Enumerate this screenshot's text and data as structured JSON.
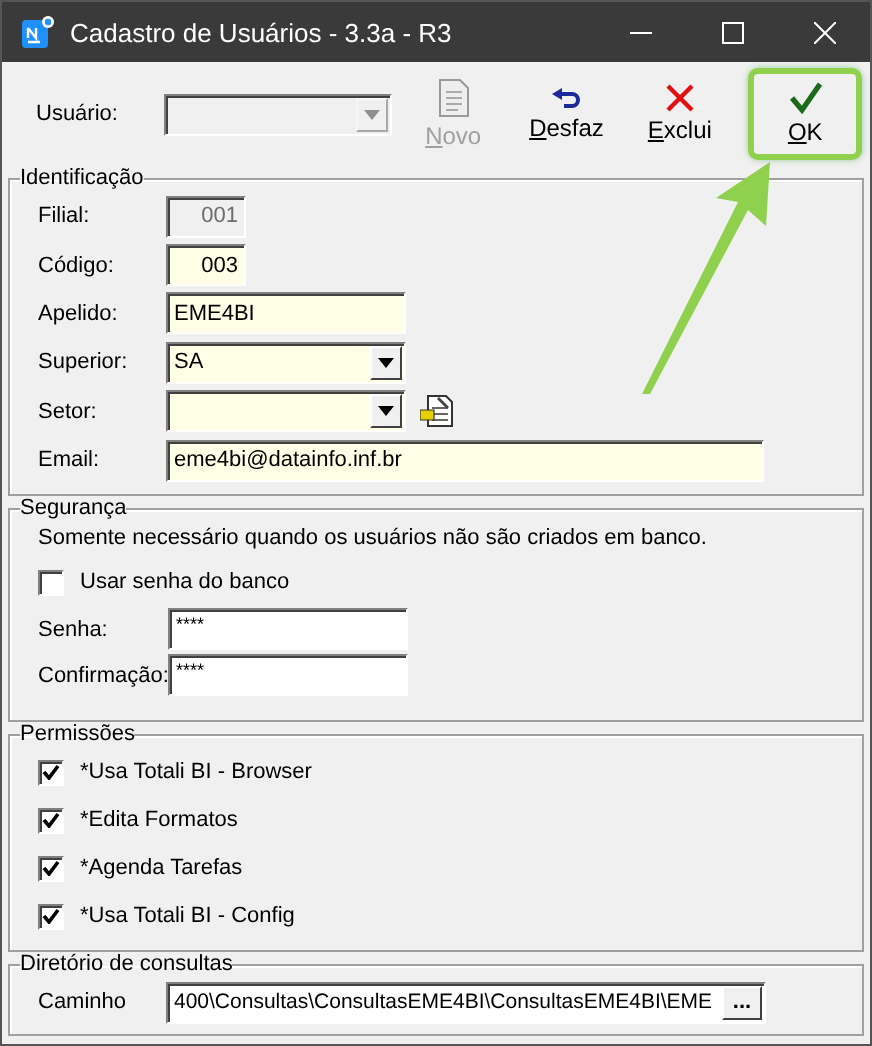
{
  "window": {
    "title": "Cadastro de Usuários - 3.3a - R3"
  },
  "toolbar": {
    "user_label": "Usuário:",
    "user_combo": {
      "disabled": true
    },
    "buttons": [
      {
        "label": "Novo",
        "kind": "new",
        "disabled": true,
        "highlighted": false
      },
      {
        "label": "Desfaz",
        "kind": "undo",
        "disabled": false,
        "highlighted": false
      },
      {
        "label": "Exclui",
        "kind": "delete",
        "disabled": false,
        "highlighted": false
      },
      {
        "label": "OK",
        "kind": "ok",
        "disabled": false,
        "highlighted": true
      }
    ]
  },
  "identificacao": {
    "title": "Identificação",
    "fields": [
      {
        "label": "Filial:",
        "kind": "code",
        "value": "001",
        "disabled": true
      },
      {
        "label": "Código:",
        "kind": "code",
        "value": "003",
        "disabled": false
      },
      {
        "label": "Apelido:",
        "kind": "text",
        "value": "EME4BI",
        "disabled": false
      },
      {
        "label": "Superior:",
        "kind": "combo",
        "value": "SA",
        "disabled": false
      },
      {
        "label": "Setor:",
        "kind": "combo",
        "disabled": false,
        "lookup": true
      },
      {
        "label": "Email:",
        "kind": "wide",
        "value": "eme4bi@datainfo.inf.br",
        "disabled": false
      }
    ]
  },
  "seguranca": {
    "title": "Segurança",
    "note": "Somente necessário quando os usuários não são criados em banco.",
    "checkbox": {
      "label": "Usar senha do banco",
      "checked": false
    },
    "fields": [
      {
        "label": "Senha:",
        "value": "****"
      },
      {
        "label": "Confirmação:",
        "value": "****"
      }
    ]
  },
  "permissoes": {
    "title": "Permissões",
    "items": [
      {
        "label": "*Usa Totali BI - Browser",
        "checked": true
      },
      {
        "label": "*Edita Formatos",
        "checked": true
      },
      {
        "label": "*Agenda Tarefas",
        "checked": true
      },
      {
        "label": "*Usa Totali BI - Config",
        "checked": true
      }
    ]
  },
  "diretorio": {
    "title": "Diretório de consultas",
    "label": "Caminho",
    "value": "400\\Consultas\\ConsultasEME4BI\\ConsultasEME4BI\\EME",
    "browse": "..."
  },
  "annotation": {
    "kind": "arrow"
  }
}
